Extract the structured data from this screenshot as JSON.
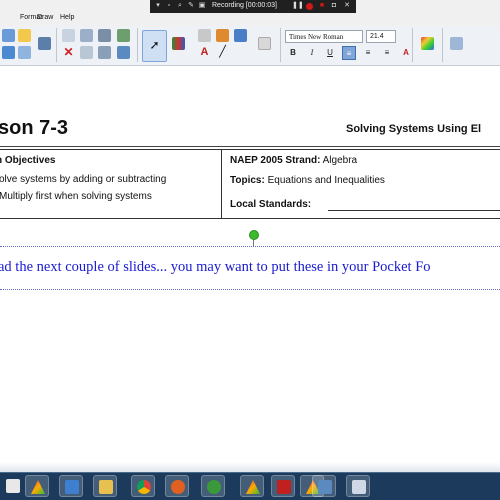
{
  "menu": {
    "items": [
      "Format",
      "Draw",
      "Help"
    ]
  },
  "recorder": {
    "status": "Recording [00:00:03]"
  },
  "toolbar": {
    "font_name": "Times New Roman",
    "font_size": "21.4",
    "bold_label": "B",
    "italic_label": "I",
    "underline_label": "U",
    "text_color_label": "A"
  },
  "lesson": {
    "title": "son 7-3",
    "subtitle": "Solving Systems Using El",
    "objectives_heading": "n Objectives",
    "objectives": [
      "olve systems by adding or subtracting",
      "Multiply first when solving systems"
    ],
    "naep_label": "NAEP 2005 Strand:",
    "naep_value": "Algebra",
    "topics_label": "Topics:",
    "topics_value": "Equations and Inequalities",
    "standards_label": "Local Standards:"
  },
  "note": {
    "text": "ad the next couple of slides... you may want to put these in your Pocket Fo"
  },
  "colors": {
    "note_text": "#1a1ad0",
    "record_red": "#d01818",
    "handle_green": "#3cba2c",
    "taskbar": "#1c3b5c"
  },
  "taskbar": {
    "icons": [
      "app-icon",
      "acrobat-icon",
      "notes-icon",
      "folder-icon",
      "chrome-icon",
      "power-icon",
      "media-icon",
      "acrobat-icon",
      "pdf-icon",
      "app-icon",
      "monitor-icon",
      "app-icon"
    ]
  }
}
